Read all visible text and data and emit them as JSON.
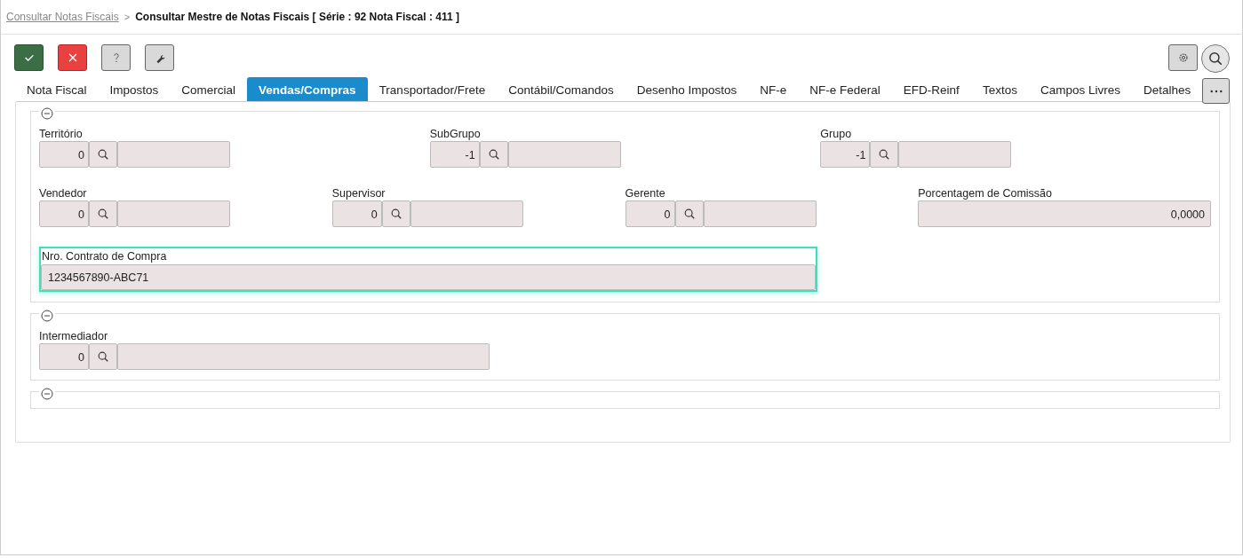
{
  "breadcrumb": {
    "parent": "Consultar Notas Fiscais",
    "separator": ">",
    "current": "Consultar Mestre de Notas Fiscais [ Série : 92 Nota Fiscal : 411 ]"
  },
  "toolbar": [
    {
      "kind": "confirm"
    },
    {
      "kind": "cancel"
    },
    {
      "kind": "help"
    },
    {
      "kind": "tools"
    }
  ],
  "toolbar_right": [
    {
      "kind": "settings"
    },
    {
      "kind": "search"
    }
  ],
  "tabs": [
    {
      "label": "Nota Fiscal",
      "selected": false
    },
    {
      "label": "Impostos",
      "selected": false
    },
    {
      "label": "Comercial",
      "selected": false
    },
    {
      "label": "Vendas/Compras",
      "selected": true
    },
    {
      "label": "Transportador/Frete",
      "selected": false
    },
    {
      "label": "Contábil/Comandos",
      "selected": false
    },
    {
      "label": "Desenho Impostos",
      "selected": false
    },
    {
      "label": "NF-e",
      "selected": false
    },
    {
      "label": "NF-e Federal",
      "selected": false
    },
    {
      "label": "EFD-Reinf",
      "selected": false
    },
    {
      "label": "Textos",
      "selected": false
    },
    {
      "label": "Campos Livres",
      "selected": false
    },
    {
      "label": "Detalhes",
      "selected": false
    }
  ],
  "sections": [
    {
      "expanded": true,
      "rows": [
        [
          {
            "kind": "lookup",
            "label": "Território",
            "code": "0"
          },
          {
            "kind": "lookup",
            "label": "SubGrupo",
            "code": "-1"
          },
          {
            "kind": "lookup",
            "label": "Grupo",
            "code": "-1"
          }
        ],
        [
          {
            "kind": "lookup",
            "label": "Vendedor",
            "code": "0"
          },
          {
            "kind": "lookup",
            "label": "Supervisor",
            "code": "0"
          },
          {
            "kind": "lookup",
            "label": "Gerente",
            "code": "0"
          },
          {
            "kind": "number",
            "label": "Porcentagem de Comissão",
            "value": "0,0000"
          }
        ],
        [
          {
            "kind": "text",
            "label": "Nro. Contrato de Compra",
            "value": "1234567890-ABC71",
            "focused": true
          }
        ]
      ]
    },
    {
      "expanded": true,
      "rows": [
        [
          {
            "kind": "lookup",
            "label": "Intermediador",
            "code": "0"
          }
        ]
      ]
    },
    {
      "expanded": true
    }
  ]
}
